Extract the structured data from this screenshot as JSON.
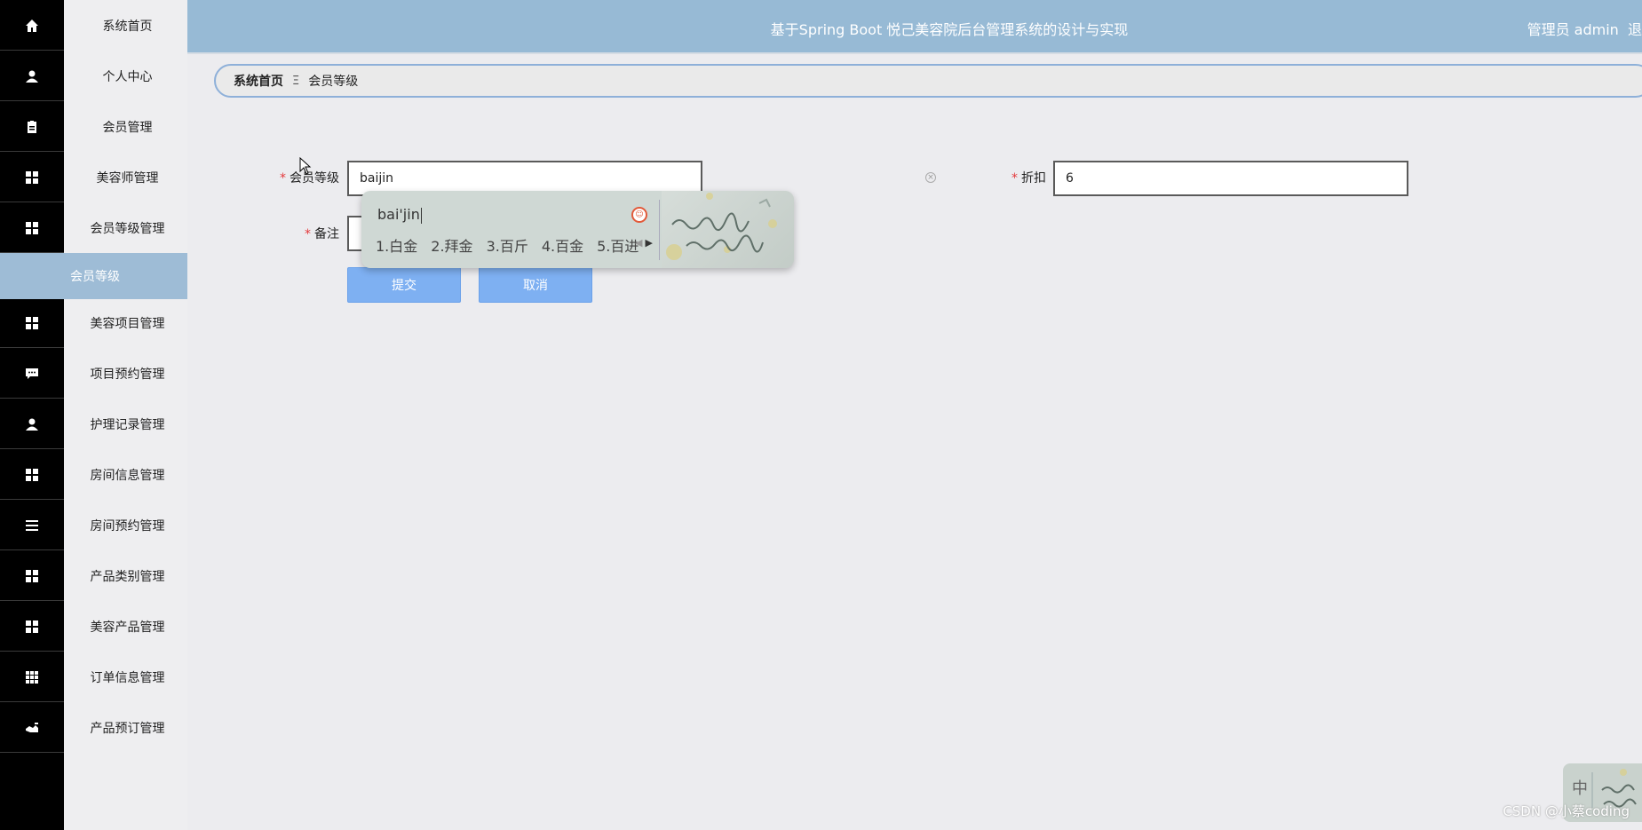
{
  "header": {
    "title": "基于Spring Boot 悦己美容院后台管理系统的设计与实现",
    "user": "管理员 admin",
    "logout": "退"
  },
  "sidebar": {
    "items": [
      {
        "label": "系统首页",
        "icon": "home-icon"
      },
      {
        "label": "个人中心",
        "icon": "user-icon"
      },
      {
        "label": "会员管理",
        "icon": "clipboard-icon"
      },
      {
        "label": "美容师管理",
        "icon": "grid-icon"
      },
      {
        "label": "会员等级管理",
        "icon": "grid-icon"
      },
      {
        "label": "美容项目管理",
        "icon": "grid-icon"
      },
      {
        "label": "项目预约管理",
        "icon": "chat-icon"
      },
      {
        "label": "护理记录管理",
        "icon": "user-icon"
      },
      {
        "label": "房间信息管理",
        "icon": "grid-icon"
      },
      {
        "label": "房间预约管理",
        "icon": "list-icon"
      },
      {
        "label": "产品类别管理",
        "icon": "grid-icon"
      },
      {
        "label": "美容产品管理",
        "icon": "grid-icon"
      },
      {
        "label": "订单信息管理",
        "icon": "table-icon"
      },
      {
        "label": "产品预订管理",
        "icon": "handshake-icon"
      }
    ],
    "active_submenu": "会员等级"
  },
  "breadcrumb": {
    "home": "系统首页",
    "separator": "Ξ",
    "current": "会员等级"
  },
  "form": {
    "level_label": "会员等级",
    "level_value": "baijin",
    "discount_label": "折扣",
    "discount_value": "6",
    "remark_label": "备注",
    "required_mark": "*",
    "submit": "提交",
    "cancel": "取消"
  },
  "ime": {
    "composition": "bai'jin",
    "candidates": [
      "1.白金",
      "2.拜金",
      "3.百斤",
      "4.百金",
      "5.百进"
    ],
    "status": "中"
  },
  "watermark": "CSDN @小蔡coding",
  "colors": {
    "header": "#97bad5",
    "active_submenu": "#9ebcd6",
    "button": "#7eb0f2",
    "breadcrumb_border": "#8eb0d9",
    "required": "#e4393c"
  }
}
